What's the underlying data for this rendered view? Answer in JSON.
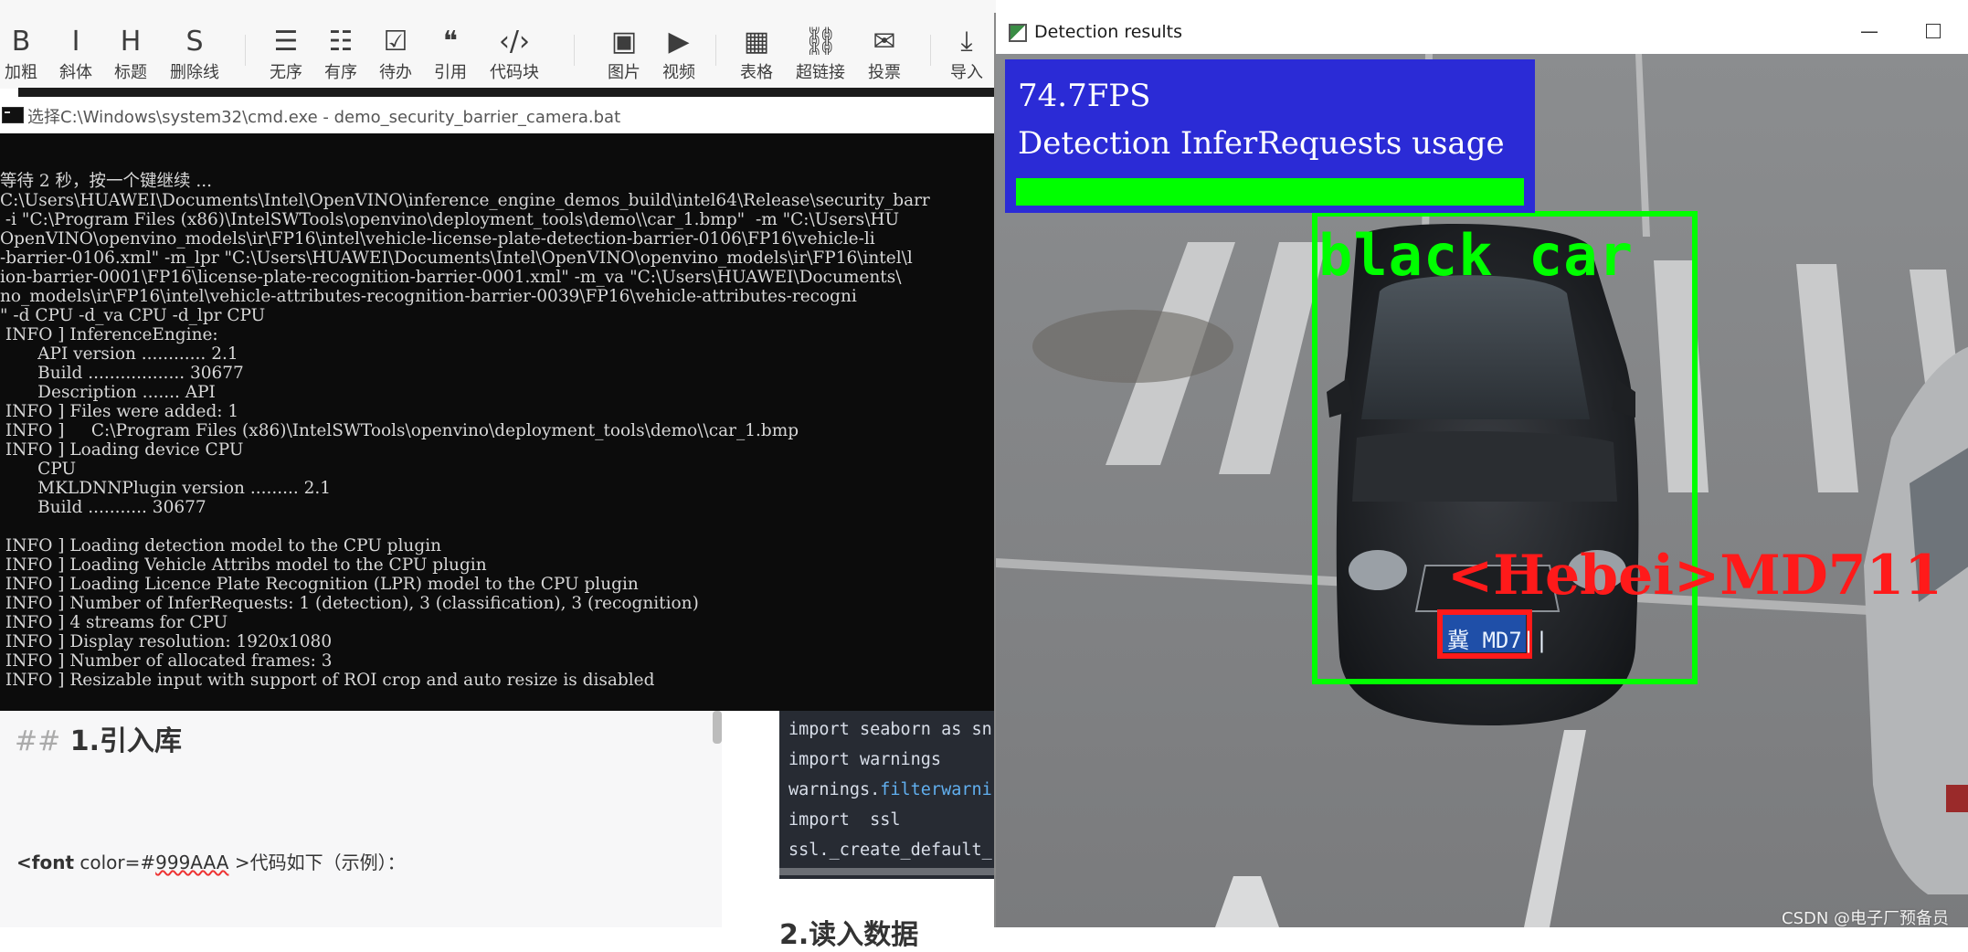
{
  "toolbar": {
    "items": [
      {
        "glyph": "B",
        "label": "加粗"
      },
      {
        "glyph": "I",
        "label": "斜体"
      },
      {
        "glyph": "H",
        "label": "标题"
      },
      {
        "glyph": "S",
        "label": "删除线"
      },
      {
        "glyph": "☰",
        "label": "无序"
      },
      {
        "glyph": "☷",
        "label": "有序"
      },
      {
        "glyph": "☑",
        "label": "待办"
      },
      {
        "glyph": "❝",
        "label": "引用"
      },
      {
        "glyph": "‹/›",
        "label": "代码块"
      },
      {
        "glyph": "▣",
        "label": "图片"
      },
      {
        "glyph": "▶",
        "label": "视频"
      },
      {
        "glyph": "▦",
        "label": "表格"
      },
      {
        "glyph": "⛓",
        "label": "超链接"
      },
      {
        "glyph": "✉",
        "label": "投票"
      },
      {
        "glyph": "⤓",
        "label": "导入"
      }
    ],
    "accent": "#f15a44"
  },
  "cmd": {
    "title": "选择C:\\Windows\\system32\\cmd.exe - demo_security_barrier_camera.bat",
    "lines": [
      "等待 2 秒，按一个键继续 ...",
      "C:\\Users\\HUAWEI\\Documents\\Intel\\OpenVINO\\inference_engine_demos_build\\intel64\\Release\\security_barr",
      " -i \"C:\\Program Files (x86)\\IntelSWTools\\openvino\\deployment_tools\\demo\\\\car_1.bmp\"  -m \"C:\\Users\\HU",
      "OpenVINO\\openvino_models\\ir\\FP16\\intel\\vehicle-license-plate-detection-barrier-0106\\FP16\\vehicle-li",
      "-barrier-0106.xml\" -m_lpr \"C:\\Users\\HUAWEI\\Documents\\Intel\\OpenVINO\\openvino_models\\ir\\FP16\\intel\\l",
      "ion-barrier-0001\\FP16\\license-plate-recognition-barrier-0001.xml\" -m_va \"C:\\Users\\HUAWEI\\Documents\\",
      "no_models\\ir\\FP16\\intel\\vehicle-attributes-recognition-barrier-0039\\FP16\\vehicle-attributes-recogni",
      "\" -d CPU -d_va CPU -d_lpr CPU",
      " INFO ] InferenceEngine:",
      "       API version ............ 2.1",
      "       Build .................. 30677",
      "       Description ....... API",
      " INFO ] Files were added: 1",
      " INFO ]     C:\\Program Files (x86)\\IntelSWTools\\openvino\\deployment_tools\\demo\\\\car_1.bmp",
      " INFO ] Loading device CPU",
      "       CPU",
      "       MKLDNNPlugin version ......... 2.1",
      "       Build ........... 30677",
      "",
      " INFO ] Loading detection model to the CPU plugin",
      " INFO ] Loading Vehicle Attribs model to the CPU plugin",
      " INFO ] Loading Licence Plate Recognition (LPR) model to the CPU plugin",
      " INFO ] Number of InferRequests: 1 (detection), 3 (classification), 3 (recognition)",
      " INFO ] 4 streams for CPU",
      " INFO ] Display resolution: 1920x1080",
      " INFO ] Number of allocated frames: 3",
      " INFO ] Resizable input with support of ROI crop and auto resize is disabled"
    ]
  },
  "editor": {
    "heading_hash": "##",
    "heading_text": "1.引入库",
    "font_tag_open": "<font",
    "font_attr": " color=#",
    "font_attr_value": "999AAA",
    "font_tag_close": " >",
    "font_text": "代码如下（示例）："
  },
  "code": {
    "lines": [
      {
        "kw": "import",
        "rest": " seaborn as sn"
      },
      {
        "kw": "import",
        "rest": " warnings"
      },
      {
        "kw": "warnings.",
        "fn": "filterwarni"
      },
      {
        "kw": "import",
        "rest": "  ssl"
      },
      {
        "kw": "ssl.",
        "rest": "_create_default_"
      }
    ]
  },
  "preview": {
    "heading": "2.读入数据"
  },
  "detection": {
    "window_title": "Detection results",
    "fps": "74.7FPS",
    "usage_label": "Detection InferRequests usage",
    "usage_fraction": 1.0,
    "vehicle_label": "black car",
    "plate_label": "<Hebei>MD711",
    "plate_text": "冀 MD7||",
    "watermark": "CSDN @电子厂预备员",
    "colors": {
      "hud": "#2b2bd6",
      "box": "#00ff00",
      "plate": "#ff1a1a"
    }
  }
}
